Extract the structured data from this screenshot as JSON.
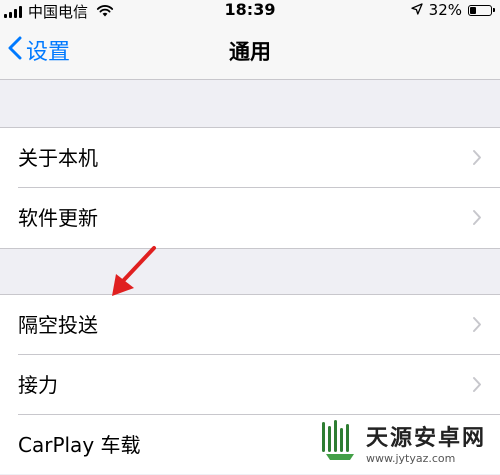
{
  "status_bar": {
    "carrier": "中国电信",
    "time": "18:39",
    "battery": "32%",
    "battery_level": 0.32
  },
  "nav": {
    "back_label": "设置",
    "title": "通用"
  },
  "groups": [
    {
      "items": [
        {
          "label": "关于本机"
        },
        {
          "label": "软件更新"
        }
      ]
    },
    {
      "items": [
        {
          "label": "隔空投送"
        },
        {
          "label": "接力"
        },
        {
          "label": "CarPlay 车载"
        }
      ]
    }
  ],
  "annotation": {
    "color": "#e02020"
  },
  "watermark": {
    "name": "天源安卓网",
    "url": "www.jytyaz.com"
  },
  "colors": {
    "accent": "#007aff",
    "background": "#efeff4"
  }
}
